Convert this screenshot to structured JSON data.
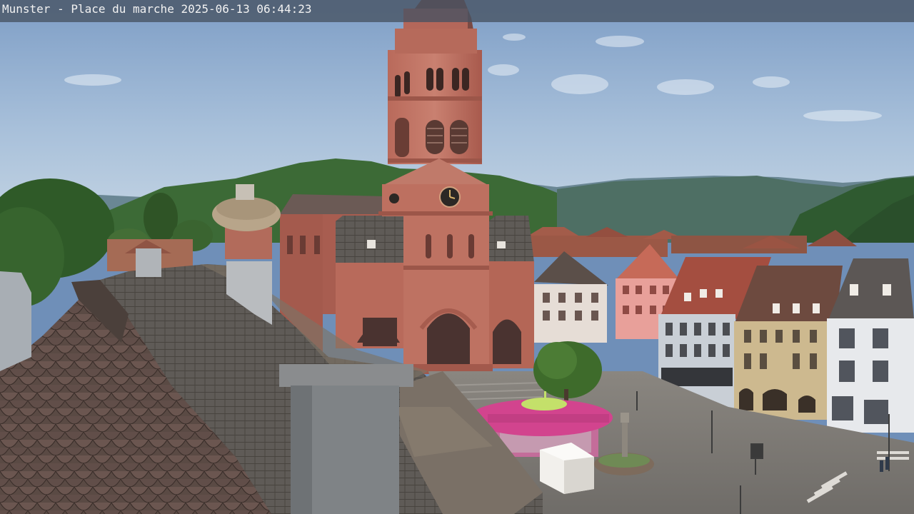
{
  "overlay": {
    "caption": "Munster - Place du marche 2025-06-13 06:44:23"
  },
  "scene": {
    "church_clock": "clock-face"
  },
  "colors": {
    "sky_top": "#7f9fc8",
    "sky_bottom": "#b9cde0",
    "sandstone": "#b8685a",
    "roof_slate": "#5a5652",
    "carousel_pink": "#d43f8c",
    "hills": "#3f6b3a"
  }
}
